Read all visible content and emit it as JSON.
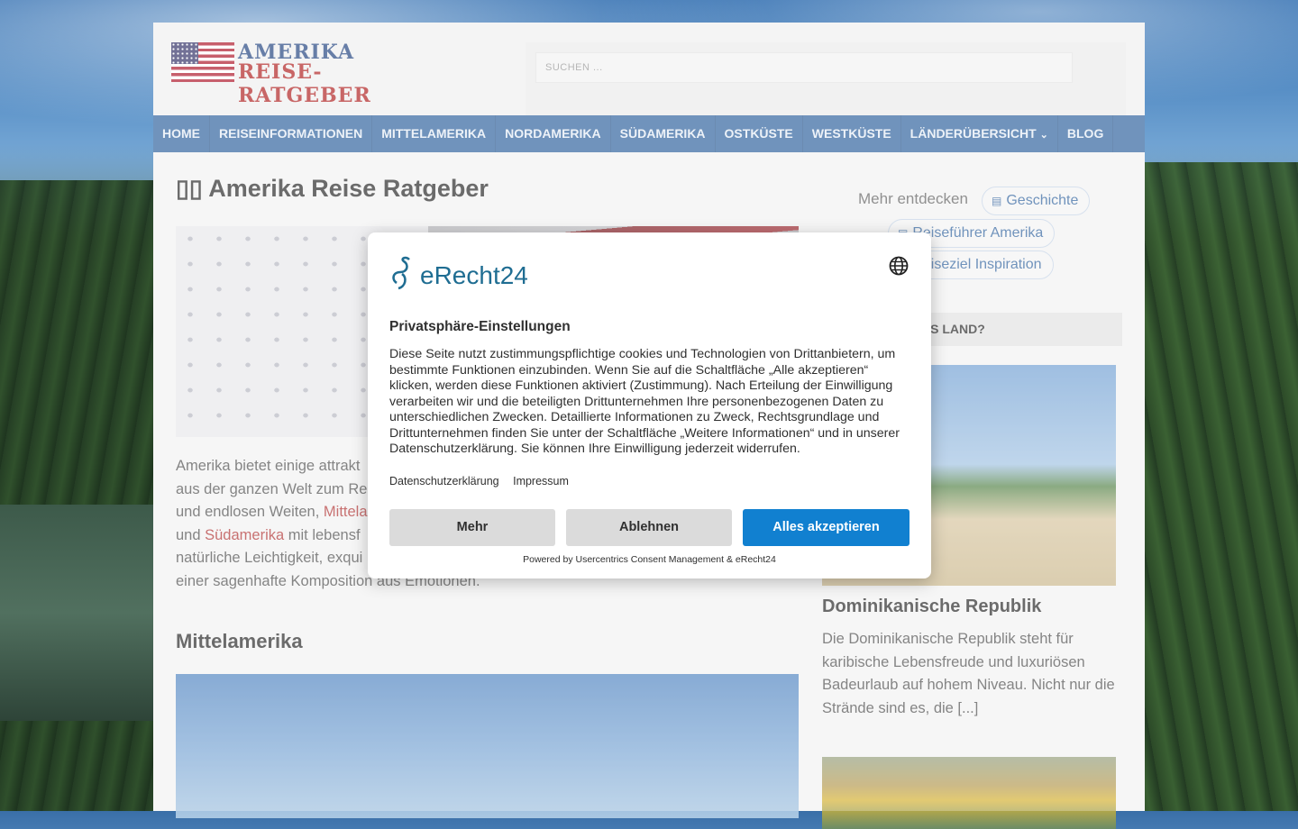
{
  "site": {
    "logo_line1": "AMERIKA",
    "logo_line2": "REISE-RATGEBER",
    "search_placeholder": "SUCHEN ..."
  },
  "nav": {
    "items": [
      {
        "label": "HOME"
      },
      {
        "label": "REISEINFORMATIONEN"
      },
      {
        "label": "MITTELAMERIKA"
      },
      {
        "label": "NORDAMERIKA"
      },
      {
        "label": "SÜDAMERIKA"
      },
      {
        "label": "OSTKÜSTE"
      },
      {
        "label": "WESTKÜSTE"
      },
      {
        "label": "LÄNDERÜBERSICHT",
        "has_dropdown": true
      },
      {
        "label": "BLOG"
      }
    ]
  },
  "main": {
    "title": "▯▯ Amerika Reise Ratgeber",
    "intro_parts": [
      "Amerika bietet einige attrakt",
      "aus der ganzen Welt zum Re",
      "und endlosen Weiten, ",
      "Mittela",
      "und ",
      "Südamerika",
      " mit lebensf",
      "natürliche Leichtigkeit, exqui",
      "einer sagenhafte Komposition aus Emotionen."
    ],
    "section_heading": "Mittelamerika"
  },
  "sidebar": {
    "more_label": "Mehr entdecken",
    "pills": [
      {
        "label": "Geschichte",
        "icon": "newspaper-icon"
      },
      {
        "label": "Reiseführer Amerika",
        "icon": "newspaper-icon"
      },
      {
        "label": "Reiseziel Inspiration",
        "icon": "newspaper-icon"
      }
    ],
    "widget_title": "AS LAND?",
    "card_title": "Dominikanische Republik",
    "card_text": "Die Dominikanische Republik steht für karibische Lebensfreude und luxuriösen Badeurlaub auf hohem Niveau. Nicht nur die Strände sind es, die [...]"
  },
  "consent": {
    "brand": "eRecht24",
    "title": "Privatsphäre-Einstellungen",
    "body": "Diese Seite nutzt zustimmungspflichtige cookies und Technologien von Drittanbietern, um bestimmte Funktionen einzubinden. Wenn Sie auf die Schaltfläche „Alle akzeptieren“ klicken, werden diese Funktionen aktiviert (Zustimmung). Nach Erteilung der Einwilligung verarbeiten wir und die beteiligten Drittunternehmen Ihre personenbezogenen Daten zu unterschiedlichen Zwecken. Detaillierte Informationen zu Zweck, Rechtsgrundlage und Drittunternehmen finden Sie unter der Schaltfläche „Weitere Informationen“ und in unserer Datenschutzerklärung. Sie können Ihre Einwilligung jederzeit widerrufen.",
    "link_privacy": "Datenschutzerklärung",
    "link_imprint": "Impressum",
    "btn_more": "Mehr",
    "btn_decline": "Ablehnen",
    "btn_accept": "Alles akzeptieren",
    "powered_by": "Powered by Usercentrics Consent Management & eRecht24",
    "accent_color": "#1180d0"
  }
}
